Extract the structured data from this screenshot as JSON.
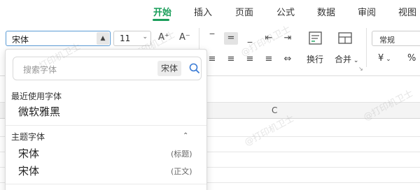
{
  "tabs": [
    {
      "label": "开始",
      "active": true
    },
    {
      "label": "插入"
    },
    {
      "label": "页面"
    },
    {
      "label": "公式"
    },
    {
      "label": "数据"
    },
    {
      "label": "审阅"
    },
    {
      "label": "视图"
    }
  ],
  "ribbon": {
    "font_name": "宋体",
    "font_size": "11",
    "grow_font": "A⁺",
    "shrink_font": "A⁻",
    "wrap_text_label": "换行",
    "merge_label": "合并",
    "number_format": "常规",
    "currency_symbol": "¥",
    "percent_symbol": "%"
  },
  "dropdown": {
    "search_placeholder": "搜索字体",
    "search_chip": "宋体",
    "recent_label": "最近使用字体",
    "recent_fonts": [
      "微软雅黑"
    ],
    "theme_label": "主题字体",
    "theme_fonts": [
      {
        "name": "宋体",
        "tag": "(标题)"
      },
      {
        "name": "宋体",
        "tag": "(正文)"
      }
    ]
  },
  "sheet": {
    "column_c": "C"
  },
  "watermark": "@打印机卫士",
  "colors": {
    "accent": "#1a9e5a",
    "focus_border": "#5b9bd5"
  }
}
